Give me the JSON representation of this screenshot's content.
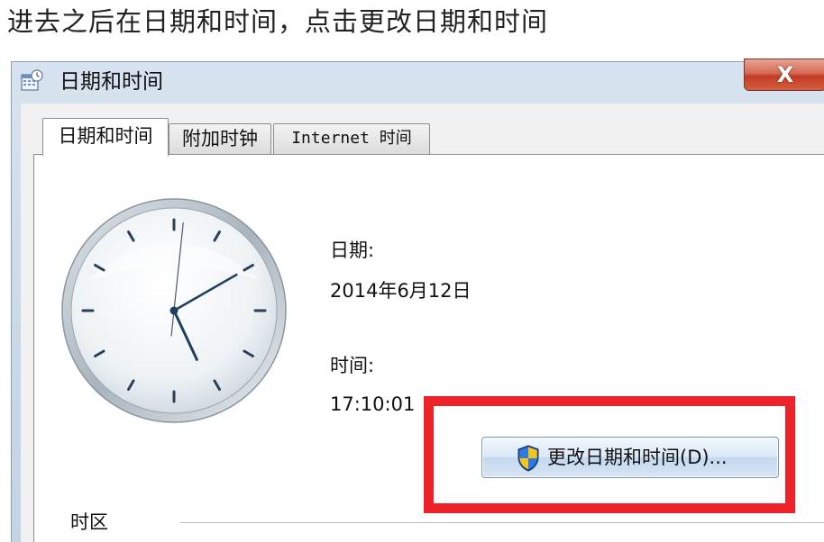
{
  "caption": "进去之后在日期和时间，点击更改日期和时间",
  "window": {
    "title": "日期和时间",
    "close_label": "X"
  },
  "tabs": [
    {
      "label": "日期和时间",
      "active": true
    },
    {
      "label": "附加时钟",
      "active": false
    },
    {
      "label": "Internet 时间",
      "active": false
    }
  ],
  "date": {
    "label": "日期:",
    "value": "2014年6月12日"
  },
  "time": {
    "label": "时间:",
    "value": "17:10:01"
  },
  "clock": {
    "hour": 17,
    "minute": 10,
    "second": 1
  },
  "change_button": {
    "label": "更改日期和时间(D)...",
    "icon": "uac-shield-icon"
  },
  "timezone": {
    "label": "时区"
  },
  "colors": {
    "highlight": "#ec2228",
    "hand": "#1f3f5f"
  }
}
